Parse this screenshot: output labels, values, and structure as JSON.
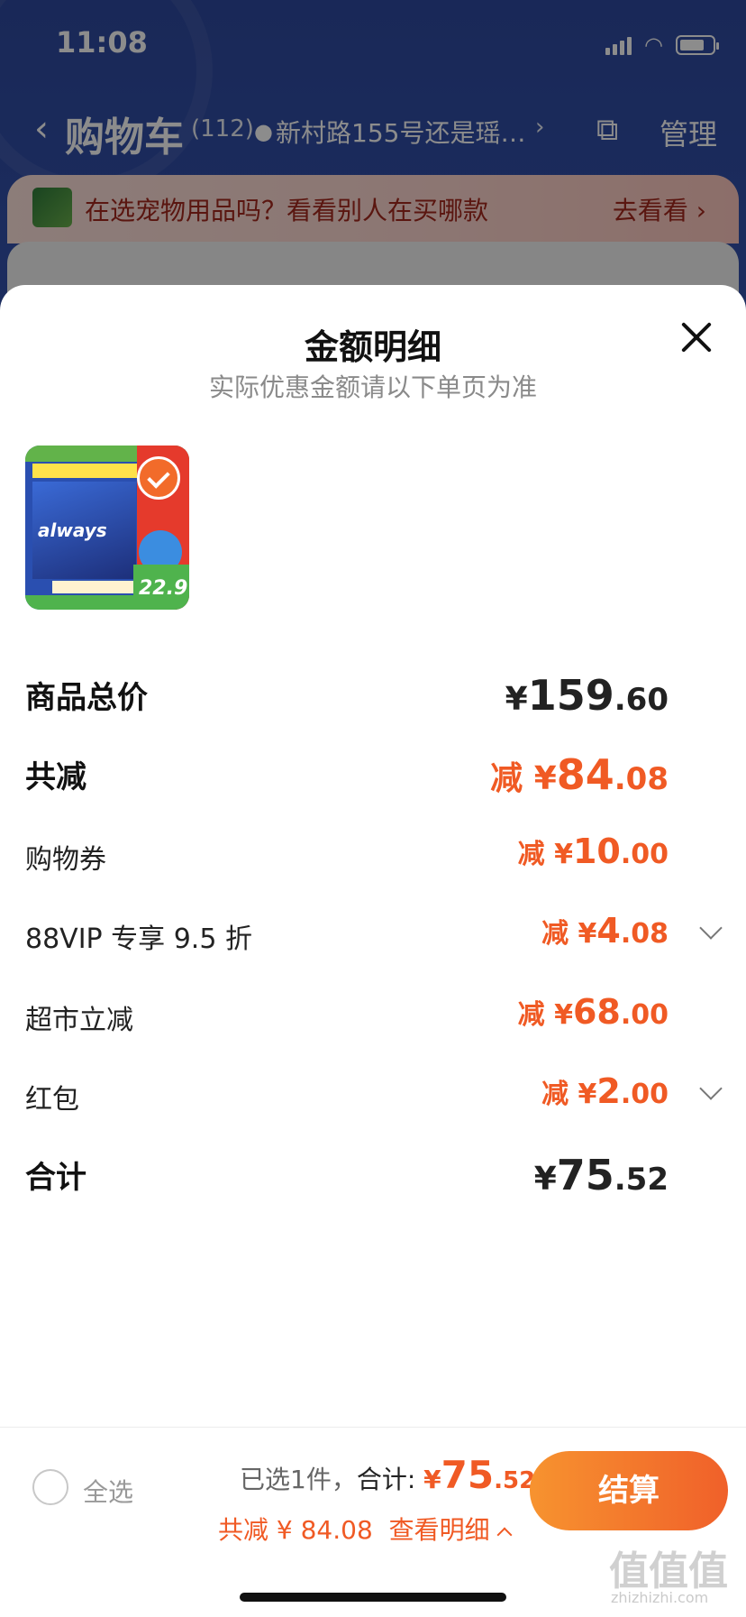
{
  "status_bar": {
    "time": "11:08"
  },
  "header": {
    "title": "购物车",
    "count": "(112)",
    "location": "新村路155号还是瑶…",
    "manage": "管理"
  },
  "promo": {
    "text": "在选宠物用品吗？看看别人在买哪款",
    "action": "去看看"
  },
  "sheet": {
    "title": "金额明细",
    "subtitle": "实际优惠金额请以下单页为准",
    "product": {
      "brand": "always",
      "price_tag": "22.9"
    },
    "rows": [
      {
        "label": "商品总价",
        "minus": "",
        "yen": "¥",
        "int": "159",
        "dec": ".60"
      },
      {
        "label": "共减",
        "minus": "减 ",
        "yen": "¥",
        "int": "84",
        "dec": ".08"
      },
      {
        "label": "购物券",
        "minus": "减 ",
        "yen": "¥",
        "int": "10",
        "dec": ".00"
      },
      {
        "label": "88VIP 专享 9.5 折",
        "minus": "减 ",
        "yen": "¥",
        "int": "4",
        "dec": ".08"
      },
      {
        "label": "超市立减",
        "minus": "减 ",
        "yen": "¥",
        "int": "68",
        "dec": ".00"
      },
      {
        "label": "红包",
        "minus": "减 ",
        "yen": "¥",
        "int": "2",
        "dec": ".00"
      },
      {
        "label": "合计",
        "minus": "",
        "yen": "¥",
        "int": "75",
        "dec": ".52"
      }
    ]
  },
  "bottom": {
    "select_all": "全选",
    "selected_text": "已选1件，",
    "total_label": "合计:",
    "total_yen": "¥",
    "total_int": "75",
    "total_dec": ".52",
    "saved_text": "共减 ¥ 84.08",
    "detail_link": "查看明细",
    "checkout": "结算"
  },
  "watermark": {
    "text": "值值值",
    "sub": "zhizhizhi.com"
  },
  "colors": {
    "accent": "#f05a24",
    "header_bg": "#2f4aa0",
    "checkout_start": "#f7932f",
    "checkout_end": "#f0602a"
  }
}
